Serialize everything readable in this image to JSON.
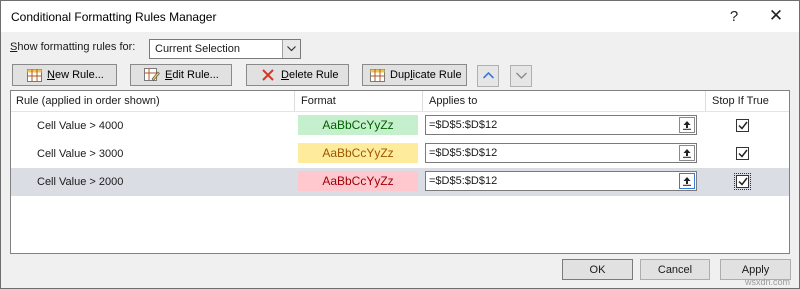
{
  "window": {
    "title": "Conditional Formatting Rules Manager",
    "help_icon": "?",
    "close_icon": "✕"
  },
  "scope": {
    "label_prefix": "S",
    "label_rest": "how formatting rules for:",
    "selected": "Current Selection"
  },
  "toolbar": {
    "new_rule": {
      "underline": "N",
      "rest": "ew Rule..."
    },
    "edit_rule": {
      "underline": "E",
      "rest": "dit Rule..."
    },
    "delete_rule": {
      "underline": "D",
      "rest": "elete Rule"
    },
    "duplicate_rule": {
      "prefix": "Dup",
      "underline": "l",
      "rest": "icate Rule"
    }
  },
  "table": {
    "headers": {
      "rule": "Rule (applied in order shown)",
      "format": "Format",
      "applies_to": "Applies to",
      "stop_if_true": "Stop If True"
    },
    "rows": [
      {
        "rule": "Cell Value > 4000",
        "format_preview": "AaBbCcYyZz",
        "format_bg": "#c6efce",
        "format_fg": "#006100",
        "applies_to": "=$D$5:$D$12",
        "stop_if_true": true,
        "selected": false
      },
      {
        "rule": "Cell Value > 3000",
        "format_preview": "AaBbCcYyZz",
        "format_bg": "#ffeb9c",
        "format_fg": "#9c5700",
        "applies_to": "=$D$5:$D$12",
        "stop_if_true": true,
        "selected": false
      },
      {
        "rule": "Cell Value > 2000",
        "format_preview": "AaBbCcYyZz",
        "format_bg": "#ffc7ce",
        "format_fg": "#9c0006",
        "applies_to": "=$D$5:$D$12",
        "stop_if_true": true,
        "selected": true
      }
    ]
  },
  "buttons": {
    "ok": "OK",
    "cancel": "Cancel",
    "apply": "Apply"
  },
  "watermark": "wsxdn.com",
  "colors": {
    "selected_row": "#dadde3",
    "up_arrow": "#3c7ad6"
  }
}
